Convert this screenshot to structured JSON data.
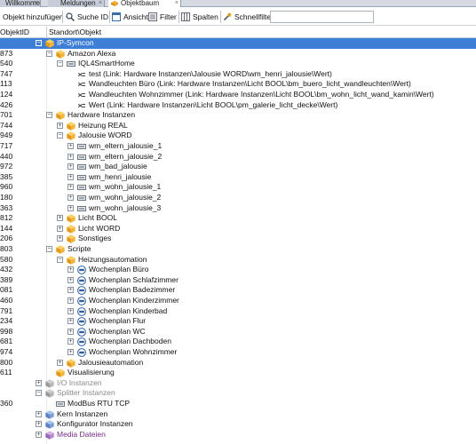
{
  "tabs": [
    {
      "label": "Willkommen",
      "active": false
    },
    {
      "label": "Meldungen",
      "active": false
    },
    {
      "label": "Objektbaum",
      "active": true
    }
  ],
  "toolbar": {
    "add_label": "Objekt hinzufügen",
    "search_id_label": "Suche ID",
    "view_label": "Ansicht",
    "filter_label": "Filter",
    "columns_label": "Spalten",
    "quickfilter_label": "Schnellfilter",
    "quickfilter_value": ""
  },
  "columns": {
    "id": "ObjektID",
    "location": "Standort\\Objekt"
  },
  "tree": [
    {
      "id": "",
      "label": "IP-Symcon",
      "depth": 0,
      "icon": "cube-icon",
      "toggle": "-",
      "selected": true
    },
    {
      "id": "873",
      "label": "Amazon Alexa",
      "depth": 1,
      "icon": "cube-icon",
      "toggle": "-"
    },
    {
      "id": "540",
      "label": "IQL4SmartHome",
      "depth": 2,
      "icon": "module-icon",
      "toggle": "-"
    },
    {
      "id": "747",
      "label": "test (Link: Hardware Instanzen\\Jalousie WORD\\wm_henri_jalousie\\Wert)",
      "depth": 3,
      "icon": "link-icon",
      "toggle": ""
    },
    {
      "id": "113",
      "label": "Wandleuchten Büro (Link: Hardware Instanzen\\Licht BOOL\\bm_buero_licht_wandleuchten\\Wert)",
      "depth": 3,
      "icon": "link-icon",
      "toggle": ""
    },
    {
      "id": "124",
      "label": "Wandleuchten Wohnzimmer (Link: Hardware Instanzen\\Licht BOOL\\bm_wohn_licht_wand_kamin\\Wert)",
      "depth": 3,
      "icon": "link-icon",
      "toggle": ""
    },
    {
      "id": "426",
      "label": "Wert (Link: Hardware Instanzen\\Licht BOOL\\pm_galerie_licht_decke\\Wert)",
      "depth": 3,
      "icon": "link-icon",
      "toggle": ""
    },
    {
      "id": "701",
      "label": "Hardware Instanzen",
      "depth": 1,
      "icon": "cube-icon",
      "toggle": "-"
    },
    {
      "id": "744",
      "label": "Heizung REAL",
      "depth": 2,
      "icon": "cube-icon",
      "toggle": "+"
    },
    {
      "id": "949",
      "label": "Jalousie WORD",
      "depth": 2,
      "icon": "cube-icon",
      "toggle": "-"
    },
    {
      "id": "717",
      "label": "wm_eltern_jalousie_1",
      "depth": 3,
      "icon": "module-icon",
      "toggle": "+"
    },
    {
      "id": "440",
      "label": "wm_eltern_jalousie_2",
      "depth": 3,
      "icon": "module-icon",
      "toggle": "+"
    },
    {
      "id": "972",
      "label": "wm_bad_jalousie",
      "depth": 3,
      "icon": "module-icon",
      "toggle": "+"
    },
    {
      "id": "385",
      "label": "wm_henri_jalousie",
      "depth": 3,
      "icon": "module-icon",
      "toggle": "+"
    },
    {
      "id": "960",
      "label": "wm_wohn_jalousie_1",
      "depth": 3,
      "icon": "module-icon",
      "toggle": "+"
    },
    {
      "id": "180",
      "label": "wm_wohn_jalousie_2",
      "depth": 3,
      "icon": "module-icon",
      "toggle": "+"
    },
    {
      "id": "363",
      "label": "wm_wohn_jalousie_3",
      "depth": 3,
      "icon": "module-icon",
      "toggle": "+"
    },
    {
      "id": "812",
      "label": "Licht BOOL",
      "depth": 2,
      "icon": "cube-icon",
      "toggle": "+"
    },
    {
      "id": "144",
      "label": "Licht WORD",
      "depth": 2,
      "icon": "cube-icon",
      "toggle": "+"
    },
    {
      "id": "206",
      "label": "Sonstiges",
      "depth": 2,
      "icon": "cube-icon",
      "toggle": "+"
    },
    {
      "id": "803",
      "label": "Scripte",
      "depth": 1,
      "icon": "cube-icon",
      "toggle": "-"
    },
    {
      "id": "580",
      "label": "Heizungsautomation",
      "depth": 2,
      "icon": "cube-icon",
      "toggle": "-"
    },
    {
      "id": "432",
      "label": "Wochenplan Büro",
      "depth": 3,
      "icon": "weekplan-icon",
      "toggle": "+"
    },
    {
      "id": "389",
      "label": "Wochenplan Schlafzimmer",
      "depth": 3,
      "icon": "weekplan-icon",
      "toggle": "+"
    },
    {
      "id": "081",
      "label": "Wochenplan Badezimmer",
      "depth": 3,
      "icon": "weekplan-icon",
      "toggle": "+"
    },
    {
      "id": "460",
      "label": "Wochenplan Kinderzimmer",
      "depth": 3,
      "icon": "weekplan-icon",
      "toggle": "+"
    },
    {
      "id": "791",
      "label": "Wochenplan Kinderbad",
      "depth": 3,
      "icon": "weekplan-icon",
      "toggle": "+"
    },
    {
      "id": "234",
      "label": "Wochenplan Flur",
      "depth": 3,
      "icon": "weekplan-icon",
      "toggle": "+"
    },
    {
      "id": "998",
      "label": "Wochenplan WC",
      "depth": 3,
      "icon": "weekplan-icon",
      "toggle": "+"
    },
    {
      "id": "681",
      "label": "Wochenplan Dachboden",
      "depth": 3,
      "icon": "weekplan-icon",
      "toggle": "+"
    },
    {
      "id": "974",
      "label": "Wochenplan Wohnzimmer",
      "depth": 3,
      "icon": "weekplan-icon",
      "toggle": "+"
    },
    {
      "id": "800",
      "label": "Jalousieautomation",
      "depth": 2,
      "icon": "cube-icon",
      "toggle": "+"
    },
    {
      "id": "611",
      "label": "Visualisierung",
      "depth": 1,
      "icon": "cube-icon",
      "toggle": ""
    },
    {
      "id": "",
      "label": "I/O Instanzen",
      "depth": 0,
      "icon": "cube-grey-icon",
      "toggle": "+",
      "style": "dim"
    },
    {
      "id": "",
      "label": "Splitter Instanzen",
      "depth": 0,
      "icon": "cube-grey-icon",
      "toggle": "-",
      "style": "dim"
    },
    {
      "id": "360",
      "label": "ModBus RTU TCP",
      "depth": 1,
      "icon": "module-icon",
      "toggle": ""
    },
    {
      "id": "",
      "label": "Kern Instanzen",
      "depth": 0,
      "icon": "cube-blue-icon",
      "toggle": "+"
    },
    {
      "id": "",
      "label": "Konfigurator Instanzen",
      "depth": 0,
      "icon": "cube-blue-icon",
      "toggle": "+"
    },
    {
      "id": "",
      "label": "Media Dateien",
      "depth": 0,
      "icon": "cube-purple-icon",
      "toggle": "+",
      "style": "purple"
    }
  ]
}
